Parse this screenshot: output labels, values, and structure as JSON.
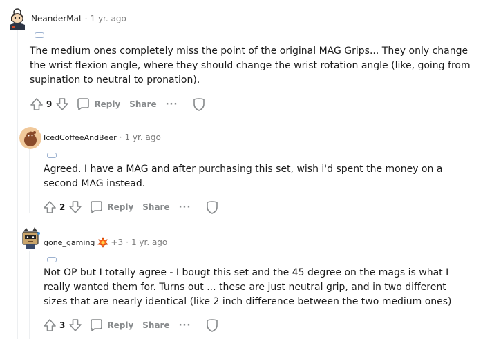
{
  "comments": [
    {
      "username": "NeanderMat",
      "separator": "·",
      "time": "1 yr. ago",
      "body": "The medium ones completely miss the point of the original MAG Grips... They only change the wrist flexion angle, where they should change the wrist rotation angle (like, going from supination to neutral to pronation).",
      "votes": "9",
      "reply_label": "Reply",
      "share_label": "Share",
      "more_label": "···"
    },
    {
      "username": "IcedCoffeeAndBeer",
      "separator": "·",
      "time": "1 yr. ago",
      "body": "Agreed. I have a MAG and after purchasing this set, wish i'd spent the money on a second MAG instead.",
      "votes": "2",
      "reply_label": "Reply",
      "share_label": "Share",
      "more_label": "···"
    },
    {
      "username": "gone_gaming",
      "karma": "+3",
      "separator": "·",
      "time": "1 yr. ago",
      "body": "Not OP but I totally agree - I bougt this set and the 45 degree on the mags is what I really wanted them for. Turns out ... these are just neutral grip, and in two different sizes that are nearly identical (like 2 inch difference between the two medium ones)",
      "votes": "3",
      "reply_label": "Reply",
      "share_label": "Share",
      "more_label": "···"
    }
  ],
  "colors": {
    "text": "#1c1c1c",
    "muted": "#878a8c",
    "thread": "#edeff1",
    "flair": "#9db2d0",
    "award": "#ff4500"
  }
}
